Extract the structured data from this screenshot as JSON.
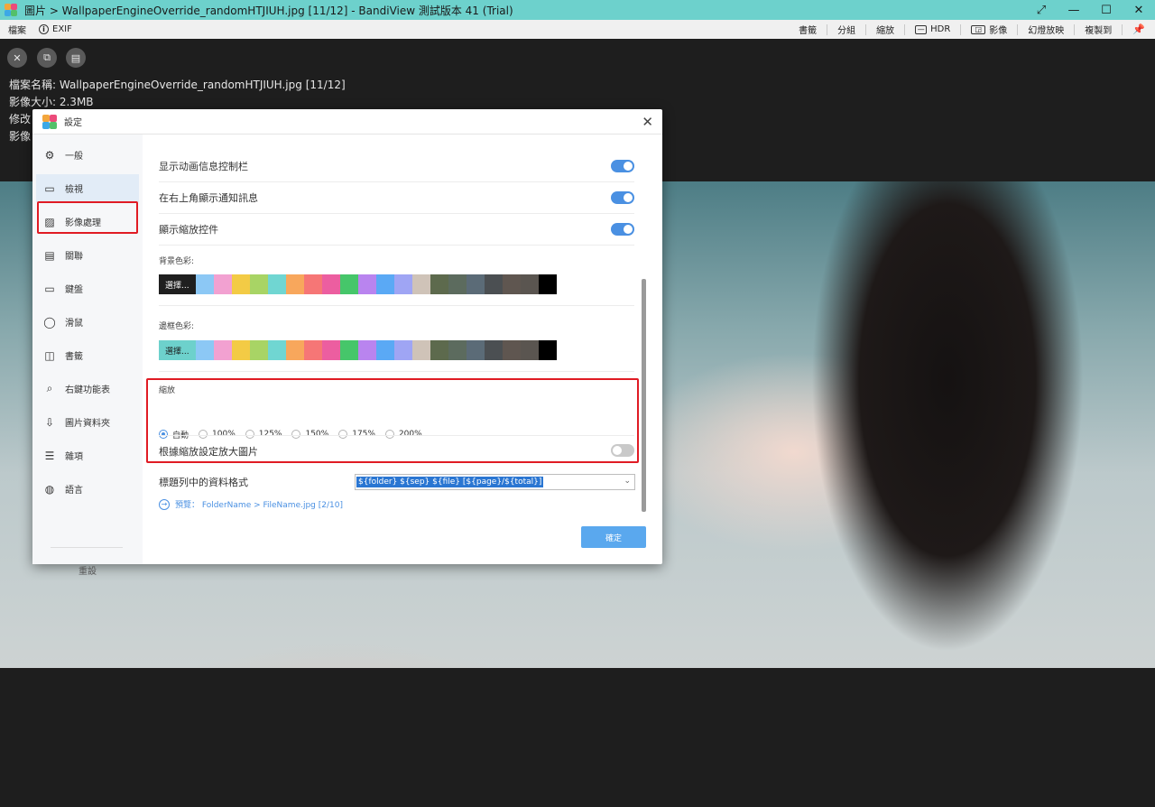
{
  "window": {
    "title": "圖片 > WallpaperEngineOverride_randomHTJIUH.jpg [11/12] - BandiView 測試版本 41 (Trial)",
    "controls": {
      "expand": "⤢",
      "minimize": "—",
      "maximize": "☐",
      "close": "✕"
    }
  },
  "menubar": {
    "left": [
      "檔案",
      "EXIF"
    ],
    "right": [
      "書籤",
      "分組",
      "縮放",
      "HDR",
      "影像",
      "幻燈放映",
      "複製到"
    ]
  },
  "viewer": {
    "buttons": {
      "close": "✕",
      "copy": "⧉",
      "file": "▤"
    },
    "meta": [
      "檔案名稱: WallpaperEngineOverride_randomHTJIUH.jpg [11/12]",
      "影像大小: 2.3MB",
      "修改",
      "影像"
    ]
  },
  "dialog": {
    "title": "設定",
    "close": "✕",
    "nav": [
      {
        "label": "一般",
        "icon": "⚙"
      },
      {
        "label": "檢視",
        "icon": "▭"
      },
      {
        "label": "影像處理",
        "icon": "▨"
      },
      {
        "label": "關聯",
        "icon": "▤"
      },
      {
        "label": "鍵盤",
        "icon": "▭"
      },
      {
        "label": "滑鼠",
        "icon": "◯"
      },
      {
        "label": "書籤",
        "icon": "◫"
      },
      {
        "label": "右鍵功能表",
        "icon": "⌕"
      },
      {
        "label": "圖片資料夾",
        "icon": "⇩"
      },
      {
        "label": "雜項",
        "icon": "☰"
      },
      {
        "label": "語言",
        "icon": "◍"
      }
    ],
    "reset": "重設",
    "settings": [
      {
        "label": "显示动画信息控制栏",
        "on": true
      },
      {
        "label": "在右上角顯示通知訊息",
        "on": true
      },
      {
        "label": "顯示縮放控件",
        "on": true
      }
    ],
    "bg_color": {
      "label": "背景色彩:",
      "pick_label": "選擇...",
      "pick_bg": "#1f1f1f",
      "pick_fg": "#ffffff",
      "colors": [
        "#8cc8f5",
        "#f2a1d1",
        "#f3cb45",
        "#a8d465",
        "#70d6d2",
        "#f8a75c",
        "#f67676",
        "#ec5ea0",
        "#46c66a",
        "#b984ef",
        "#5aa9f5",
        "#9fa5f4",
        "#cfc3b8",
        "#5d6a4d",
        "#5c6b5e",
        "#5b6b77",
        "#4b4f52",
        "#5f5650",
        "#5a5550",
        "#000000"
      ]
    },
    "border_color": {
      "label": "邊框色彩:",
      "pick_label": "選擇...",
      "pick_bg": "#6dd1cc",
      "pick_fg": "#1a1a1a",
      "colors": [
        "#8cc8f5",
        "#f2a1d1",
        "#f3cb45",
        "#a8d465",
        "#70d6d2",
        "#f8a75c",
        "#f67676",
        "#ec5ea0",
        "#46c66a",
        "#b984ef",
        "#5aa9f5",
        "#9fa5f4",
        "#cfc3b8",
        "#5d6a4d",
        "#5c6b5e",
        "#5b6b77",
        "#4b4f52",
        "#5f5650",
        "#5a5550",
        "#000000"
      ]
    },
    "zoom": {
      "label": "縮放",
      "options": [
        "自動",
        "100%",
        "125%",
        "150%",
        "175%",
        "200%"
      ],
      "selected": "自動",
      "enlarge_label": "根據縮放設定放大圖片",
      "enlarge_on": false
    },
    "title_format": {
      "label": "標題列中的資料格式",
      "value": "${folder} ${sep} ${file} [${page}/${total}]",
      "chevron": "⌄"
    },
    "preview": "預覽： FolderName > FileName.jpg [2/10]",
    "ok": "確定"
  },
  "colors": {
    "accent": "#4a90e2",
    "titlebar": "#6dd1cc",
    "highlight": "#e01b24"
  }
}
